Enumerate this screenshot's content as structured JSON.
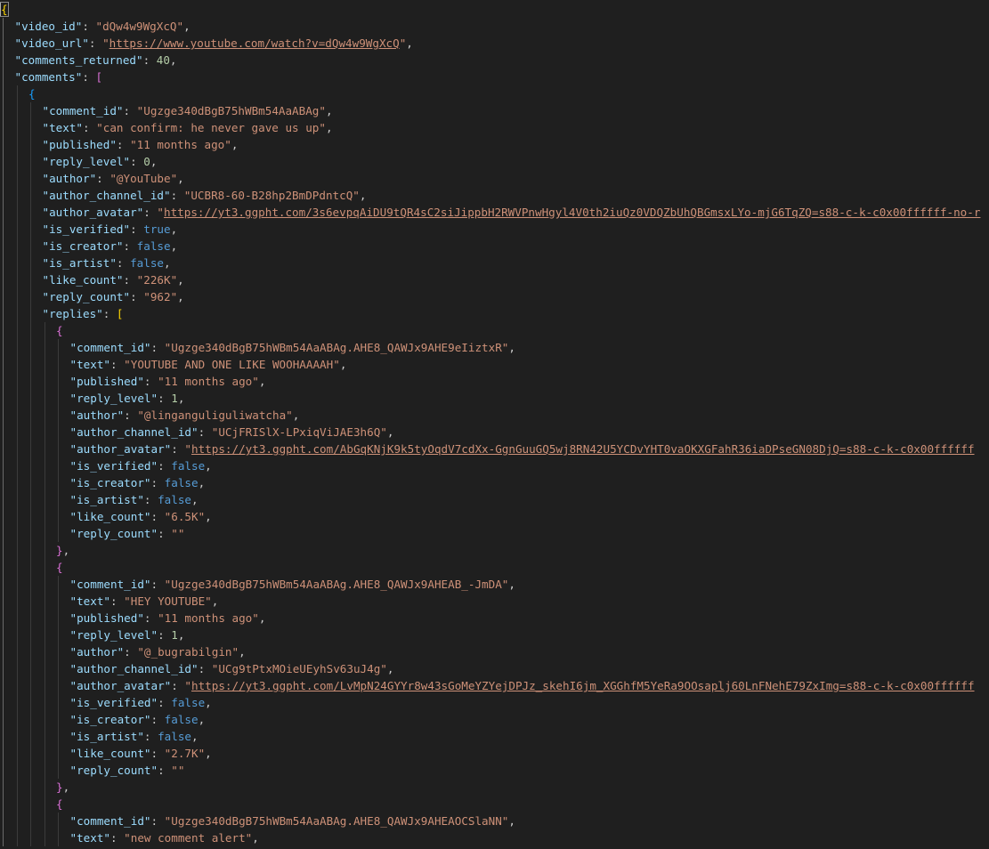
{
  "editor": {
    "language": "json",
    "colors": {
      "background": "#1f1f1f",
      "key": "#9cdcfe",
      "string": "#ce9178",
      "number": "#b5cea8",
      "boolean": "#569cd6",
      "bracket_level1": "#ffd700",
      "bracket_level2": "#da70d6",
      "bracket_level3": "#179fff"
    },
    "lines": [
      [
        {
          "t": "b",
          "v": "{"
        }
      ],
      [
        {
          "t": "k",
          "v": "\"video_id\""
        },
        {
          "t": "p",
          "v": ": "
        },
        {
          "t": "s",
          "v": "\"dQw4w9WgXcQ\""
        },
        {
          "t": "p",
          "v": ","
        }
      ],
      [
        {
          "t": "k",
          "v": "\"video_url\""
        },
        {
          "t": "p",
          "v": ": "
        },
        {
          "t": "s",
          "v": "\""
        },
        {
          "t": "u",
          "v": "https://www.youtube.com/watch?v=dQw4w9WgXcQ"
        },
        {
          "t": "s",
          "v": "\""
        },
        {
          "t": "p",
          "v": ","
        }
      ],
      [
        {
          "t": "k",
          "v": "\"comments_returned\""
        },
        {
          "t": "p",
          "v": ": "
        },
        {
          "t": "n",
          "v": "40"
        },
        {
          "t": "p",
          "v": ","
        }
      ],
      [
        {
          "t": "k",
          "v": "\"comments\""
        },
        {
          "t": "p",
          "v": ": "
        },
        {
          "t": "b",
          "v": "["
        }
      ],
      [
        {
          "t": "b",
          "v": "{"
        }
      ],
      [
        {
          "t": "k",
          "v": "\"comment_id\""
        },
        {
          "t": "p",
          "v": ": "
        },
        {
          "t": "s",
          "v": "\"Ugzge340dBgB75hWBm54AaABAg\""
        },
        {
          "t": "p",
          "v": ","
        }
      ],
      [
        {
          "t": "k",
          "v": "\"text\""
        },
        {
          "t": "p",
          "v": ": "
        },
        {
          "t": "s",
          "v": "\"can confirm: he never gave us up\""
        },
        {
          "t": "p",
          "v": ","
        }
      ],
      [
        {
          "t": "k",
          "v": "\"published\""
        },
        {
          "t": "p",
          "v": ": "
        },
        {
          "t": "s",
          "v": "\"11 months ago\""
        },
        {
          "t": "p",
          "v": ","
        }
      ],
      [
        {
          "t": "k",
          "v": "\"reply_level\""
        },
        {
          "t": "p",
          "v": ": "
        },
        {
          "t": "n",
          "v": "0"
        },
        {
          "t": "p",
          "v": ","
        }
      ],
      [
        {
          "t": "k",
          "v": "\"author\""
        },
        {
          "t": "p",
          "v": ": "
        },
        {
          "t": "s",
          "v": "\"@YouTube\""
        },
        {
          "t": "p",
          "v": ","
        }
      ],
      [
        {
          "t": "k",
          "v": "\"author_channel_id\""
        },
        {
          "t": "p",
          "v": ": "
        },
        {
          "t": "s",
          "v": "\"UCBR8-60-B28hp2BmDPdntcQ\""
        },
        {
          "t": "p",
          "v": ","
        }
      ],
      [
        {
          "t": "k",
          "v": "\"author_avatar\""
        },
        {
          "t": "p",
          "v": ": "
        },
        {
          "t": "s",
          "v": "\""
        },
        {
          "t": "u",
          "v": "https://yt3.ggpht.com/3s6evpqAiDU9tQR4sC2siJippbH2RWVPnwHgyl4V0th2iuQz0VDQZbUhQBGmsxLYo-mjG6TqZQ=s88-c-k-c0x00ffffff-no-r"
        }
      ],
      [
        {
          "t": "k",
          "v": "\"is_verified\""
        },
        {
          "t": "p",
          "v": ": "
        },
        {
          "t": "o",
          "v": "true"
        },
        {
          "t": "p",
          "v": ","
        }
      ],
      [
        {
          "t": "k",
          "v": "\"is_creator\""
        },
        {
          "t": "p",
          "v": ": "
        },
        {
          "t": "o",
          "v": "false"
        },
        {
          "t": "p",
          "v": ","
        }
      ],
      [
        {
          "t": "k",
          "v": "\"is_artist\""
        },
        {
          "t": "p",
          "v": ": "
        },
        {
          "t": "o",
          "v": "false"
        },
        {
          "t": "p",
          "v": ","
        }
      ],
      [
        {
          "t": "k",
          "v": "\"like_count\""
        },
        {
          "t": "p",
          "v": ": "
        },
        {
          "t": "s",
          "v": "\"226K\""
        },
        {
          "t": "p",
          "v": ","
        }
      ],
      [
        {
          "t": "k",
          "v": "\"reply_count\""
        },
        {
          "t": "p",
          "v": ": "
        },
        {
          "t": "s",
          "v": "\"962\""
        },
        {
          "t": "p",
          "v": ","
        }
      ],
      [
        {
          "t": "k",
          "v": "\"replies\""
        },
        {
          "t": "p",
          "v": ": "
        },
        {
          "t": "b",
          "v": "["
        }
      ],
      [
        {
          "t": "b",
          "v": "{"
        }
      ],
      [
        {
          "t": "k",
          "v": "\"comment_id\""
        },
        {
          "t": "p",
          "v": ": "
        },
        {
          "t": "s",
          "v": "\"Ugzge340dBgB75hWBm54AaABAg.AHE8_QAWJx9AHE9eIiztxR\""
        },
        {
          "t": "p",
          "v": ","
        }
      ],
      [
        {
          "t": "k",
          "v": "\"text\""
        },
        {
          "t": "p",
          "v": ": "
        },
        {
          "t": "s",
          "v": "\"YOUTUBE AND ONE LIKE WOOHAAAAH\""
        },
        {
          "t": "p",
          "v": ","
        }
      ],
      [
        {
          "t": "k",
          "v": "\"published\""
        },
        {
          "t": "p",
          "v": ": "
        },
        {
          "t": "s",
          "v": "\"11 months ago\""
        },
        {
          "t": "p",
          "v": ","
        }
      ],
      [
        {
          "t": "k",
          "v": "\"reply_level\""
        },
        {
          "t": "p",
          "v": ": "
        },
        {
          "t": "n",
          "v": "1"
        },
        {
          "t": "p",
          "v": ","
        }
      ],
      [
        {
          "t": "k",
          "v": "\"author\""
        },
        {
          "t": "p",
          "v": ": "
        },
        {
          "t": "s",
          "v": "\"@linganguliguliwatcha\""
        },
        {
          "t": "p",
          "v": ","
        }
      ],
      [
        {
          "t": "k",
          "v": "\"author_channel_id\""
        },
        {
          "t": "p",
          "v": ": "
        },
        {
          "t": "s",
          "v": "\"UCjFRISlX-LPxiqViJAE3h6Q\""
        },
        {
          "t": "p",
          "v": ","
        }
      ],
      [
        {
          "t": "k",
          "v": "\"author_avatar\""
        },
        {
          "t": "p",
          "v": ": "
        },
        {
          "t": "s",
          "v": "\""
        },
        {
          "t": "u",
          "v": "https://yt3.ggpht.com/AbGqKNjK9k5tyOqdV7cdXx-GgnGuuGQ5wj8RN42U5YCDvYHT0vaOKXGFahR36iaDPseGN08DjQ=s88-c-k-c0x00ffffff"
        }
      ],
      [
        {
          "t": "k",
          "v": "\"is_verified\""
        },
        {
          "t": "p",
          "v": ": "
        },
        {
          "t": "o",
          "v": "false"
        },
        {
          "t": "p",
          "v": ","
        }
      ],
      [
        {
          "t": "k",
          "v": "\"is_creator\""
        },
        {
          "t": "p",
          "v": ": "
        },
        {
          "t": "o",
          "v": "false"
        },
        {
          "t": "p",
          "v": ","
        }
      ],
      [
        {
          "t": "k",
          "v": "\"is_artist\""
        },
        {
          "t": "p",
          "v": ": "
        },
        {
          "t": "o",
          "v": "false"
        },
        {
          "t": "p",
          "v": ","
        }
      ],
      [
        {
          "t": "k",
          "v": "\"like_count\""
        },
        {
          "t": "p",
          "v": ": "
        },
        {
          "t": "s",
          "v": "\"6.5K\""
        },
        {
          "t": "p",
          "v": ","
        }
      ],
      [
        {
          "t": "k",
          "v": "\"reply_count\""
        },
        {
          "t": "p",
          "v": ": "
        },
        {
          "t": "s",
          "v": "\"\""
        }
      ],
      [
        {
          "t": "b",
          "v": "}"
        },
        {
          "t": "p",
          "v": ","
        }
      ],
      [
        {
          "t": "b",
          "v": "{"
        }
      ],
      [
        {
          "t": "k",
          "v": "\"comment_id\""
        },
        {
          "t": "p",
          "v": ": "
        },
        {
          "t": "s",
          "v": "\"Ugzge340dBgB75hWBm54AaABAg.AHE8_QAWJx9AHEAB_-JmDA\""
        },
        {
          "t": "p",
          "v": ","
        }
      ],
      [
        {
          "t": "k",
          "v": "\"text\""
        },
        {
          "t": "p",
          "v": ": "
        },
        {
          "t": "s",
          "v": "\"HEY YOUTUBE\""
        },
        {
          "t": "p",
          "v": ","
        }
      ],
      [
        {
          "t": "k",
          "v": "\"published\""
        },
        {
          "t": "p",
          "v": ": "
        },
        {
          "t": "s",
          "v": "\"11 months ago\""
        },
        {
          "t": "p",
          "v": ","
        }
      ],
      [
        {
          "t": "k",
          "v": "\"reply_level\""
        },
        {
          "t": "p",
          "v": ": "
        },
        {
          "t": "n",
          "v": "1"
        },
        {
          "t": "p",
          "v": ","
        }
      ],
      [
        {
          "t": "k",
          "v": "\"author\""
        },
        {
          "t": "p",
          "v": ": "
        },
        {
          "t": "s",
          "v": "\"@_bugrabilgin\""
        },
        {
          "t": "p",
          "v": ","
        }
      ],
      [
        {
          "t": "k",
          "v": "\"author_channel_id\""
        },
        {
          "t": "p",
          "v": ": "
        },
        {
          "t": "s",
          "v": "\"UCg9tPtxMOieUEyhSv63uJ4g\""
        },
        {
          "t": "p",
          "v": ","
        }
      ],
      [
        {
          "t": "k",
          "v": "\"author_avatar\""
        },
        {
          "t": "p",
          "v": ": "
        },
        {
          "t": "s",
          "v": "\""
        },
        {
          "t": "u",
          "v": "https://yt3.ggpht.com/LvMpN24GYYr8w43sGoMeYZYejDPJz_skehI6jm_XGGhfM5YeRa9OOsaplj60LnFNehE79ZxImg=s88-c-k-c0x00ffffff"
        }
      ],
      [
        {
          "t": "k",
          "v": "\"is_verified\""
        },
        {
          "t": "p",
          "v": ": "
        },
        {
          "t": "o",
          "v": "false"
        },
        {
          "t": "p",
          "v": ","
        }
      ],
      [
        {
          "t": "k",
          "v": "\"is_creator\""
        },
        {
          "t": "p",
          "v": ": "
        },
        {
          "t": "o",
          "v": "false"
        },
        {
          "t": "p",
          "v": ","
        }
      ],
      [
        {
          "t": "k",
          "v": "\"is_artist\""
        },
        {
          "t": "p",
          "v": ": "
        },
        {
          "t": "o",
          "v": "false"
        },
        {
          "t": "p",
          "v": ","
        }
      ],
      [
        {
          "t": "k",
          "v": "\"like_count\""
        },
        {
          "t": "p",
          "v": ": "
        },
        {
          "t": "s",
          "v": "\"2.7K\""
        },
        {
          "t": "p",
          "v": ","
        }
      ],
      [
        {
          "t": "k",
          "v": "\"reply_count\""
        },
        {
          "t": "p",
          "v": ": "
        },
        {
          "t": "s",
          "v": "\"\""
        }
      ],
      [
        {
          "t": "b",
          "v": "}"
        },
        {
          "t": "p",
          "v": ","
        }
      ],
      [
        {
          "t": "b",
          "v": "{"
        }
      ],
      [
        {
          "t": "k",
          "v": "\"comment_id\""
        },
        {
          "t": "p",
          "v": ": "
        },
        {
          "t": "s",
          "v": "\"Ugzge340dBgB75hWBm54AaABAg.AHE8_QAWJx9AHEAOCSlaNN\""
        },
        {
          "t": "p",
          "v": ","
        }
      ],
      [
        {
          "t": "k",
          "v": "\"text\""
        },
        {
          "t": "p",
          "v": ": "
        },
        {
          "t": "s",
          "v": "\"new comment alert\""
        },
        {
          "t": "p",
          "v": ","
        }
      ]
    ]
  }
}
